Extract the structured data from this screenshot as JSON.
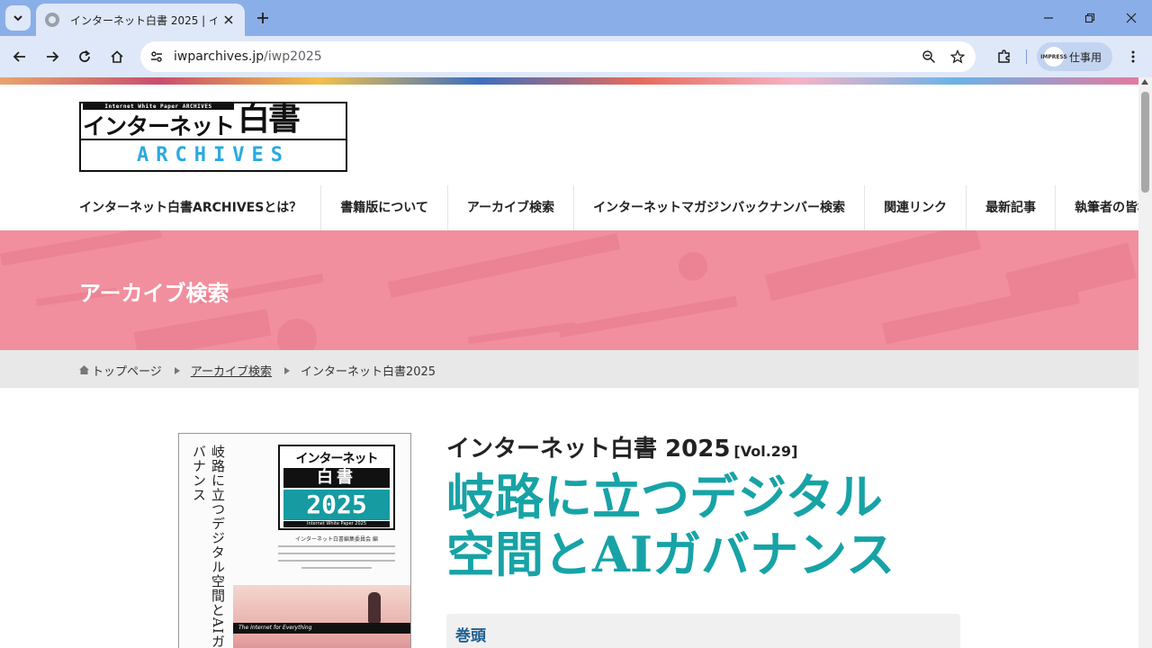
{
  "browser": {
    "tab_title": "インターネット白書 2025 | インターネ",
    "url_host": "iwparchives.jp",
    "url_path": "/iwp2025",
    "profile_avatar": "IMPRESS",
    "profile_label": "仕事用"
  },
  "site": {
    "logo_tagline": "Internet White Paper ARCHIVES",
    "logo_jp": "インターネット",
    "logo_kanji": "白書",
    "logo_archives": "ARCHIVES"
  },
  "nav": {
    "items": [
      {
        "label": "インターネット白書ARCHIVESとは？"
      },
      {
        "label": "書籍版について"
      },
      {
        "label": "アーカイブ検索"
      },
      {
        "label_line1": "インターネットマガジン",
        "label_line2": "バックナンバー検索"
      },
      {
        "label": "関連リンク"
      },
      {
        "label": "最新記事"
      },
      {
        "label": "執筆者の皆様へ"
      }
    ]
  },
  "hero": {
    "title": "アーカイブ検索"
  },
  "breadcrumb": {
    "home": "トップページ",
    "archive": "アーカイブ検索",
    "current": "インターネット白書2025"
  },
  "book": {
    "title": "インターネット白書 2025",
    "vol": "[Vol.29]",
    "subtitle_line1": "岐路に立つデジタル",
    "subtitle_line2": "空間とAIガバナンス",
    "toc_first": "巻頭"
  },
  "cover": {
    "vertical_text": "岐路に立つデジタル空間とAIガバナンス",
    "logo_top": "インターネット",
    "logo_kanji": "白書",
    "logo_year": "2025",
    "logo_sub": "Internet White Paper 2025",
    "editor": "インターネット白書編集委員会 編",
    "band_text": "The Internet for Everything"
  },
  "colors": {
    "hero_bg": "#f18f9e",
    "subtitle": "#17a3a6",
    "toc_label": "#1d5e91",
    "chrome_tabbar": "#8aaee8"
  }
}
